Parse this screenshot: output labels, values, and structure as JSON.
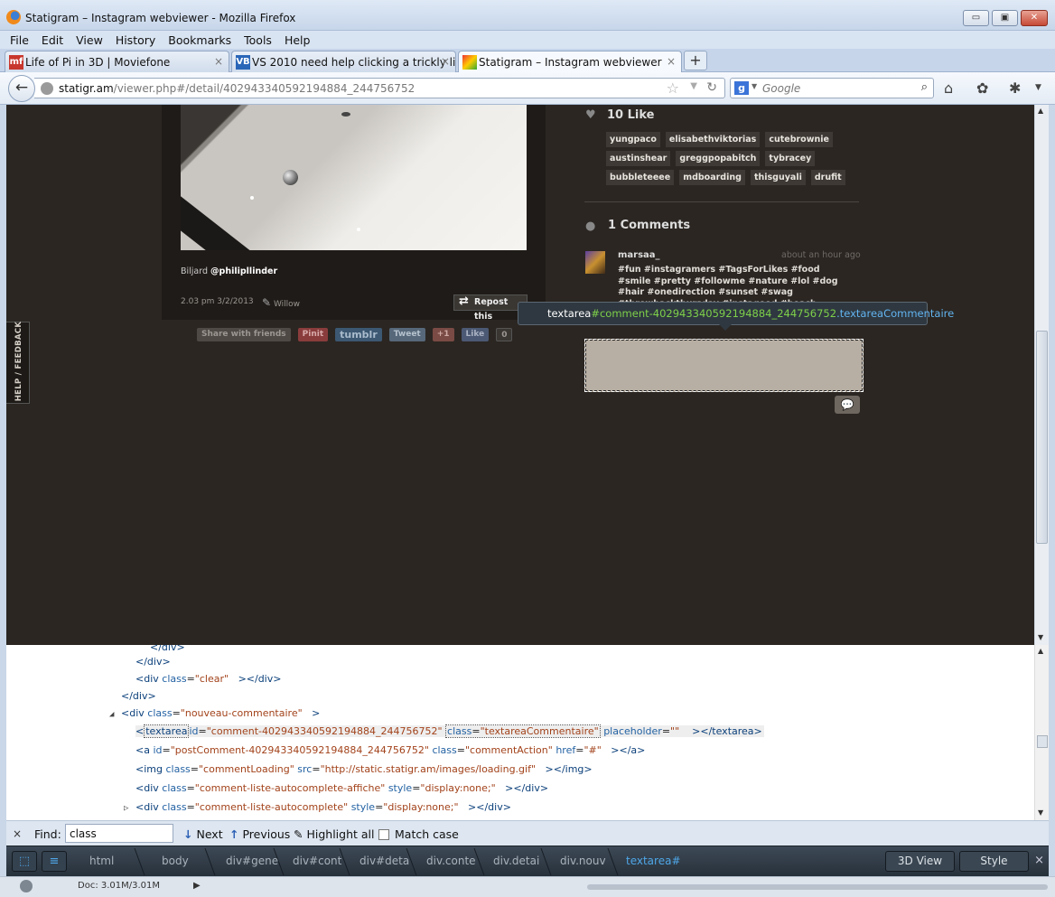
{
  "window": {
    "title": "Statigram – Instagram webviewer - Mozilla Firefox",
    "buttons": {
      "minimize": "▭",
      "restore": "▣",
      "close": "✕"
    }
  },
  "menu": [
    "File",
    "Edit",
    "View",
    "History",
    "Bookmarks",
    "Tools",
    "Help"
  ],
  "tabs": [
    {
      "label": "Life of Pi in 3D | Moviefone",
      "icon": "mf",
      "close": "×"
    },
    {
      "label": "VS 2010 need help clicking a trickly lil ...",
      "icon": "VB",
      "close": "×"
    },
    {
      "label": "Statigram – Instagram webviewer",
      "icon": "",
      "close": "×",
      "active": true
    }
  ],
  "newtab_label": "+",
  "navigation": {
    "back": "←",
    "url_host": "statigr.am",
    "url_path": "/viewer.php#/detail/402943340592194884_244756752",
    "search_placeholder": "Google",
    "search_engine_letter": "g"
  },
  "post": {
    "caption_prefix": "Biljard ",
    "caption_user": "@philipllinder",
    "time": "2.03 pm 3/2/2013",
    "filter": "Willow",
    "repost_label": "Repost this",
    "share": [
      "Share with friends",
      "Pinit",
      "tumblr",
      "Tweet",
      "+1",
      "Like",
      "0"
    ]
  },
  "feedback_label": "HELP / FEEDBACK",
  "likes": {
    "heading": "10 Like",
    "users": [
      "yungpaco",
      "elisabethviktorias",
      "cutebrownie",
      "austinshear",
      "greggpopabitch",
      "tybracey",
      "bubbleteeee",
      "mdboarding",
      "thisguyali",
      "drufit"
    ]
  },
  "comments": {
    "heading": "1 Comments",
    "user": "marsaa_",
    "time": "about an hour ago",
    "text": "#fun #instagramers #TagsForLikes #food #smile #pretty #followme #nature #lol #dog #hair #onedirection #sunset #swag #throwbackthursday #instagood #beach #statigram #friends #hot #funny #bestoftheday #clouds",
    "send_icon": "💬"
  },
  "inspector_tip": {
    "tag": "textarea",
    "id": "#comment-402943340592194884_244756752",
    "cls": ".textareaCommentaire"
  },
  "devtools": {
    "lines": {
      "l0": "</div>",
      "l1": "</div>",
      "l2_tag": "<div ",
      "l2_attr": "class",
      "l2_val": "\"clear\"",
      "l2_end": "></div>",
      "l3": "</div>",
      "l4_tag": "<div ",
      "l4_attr": "class",
      "l4_val": "\"nouveau-commentaire\"",
      "l4_end": ">",
      "l5_tag": "textarea",
      "l5_id_attr": "id",
      "l5_id_val": "\"comment-402943340592194884_244756752\"",
      "l5_cls_attr": "class",
      "l5_cls_val": "\"textareaCommentaire\"",
      "l5_ph_attr": "placeholder",
      "l5_ph_val": "\"\"",
      "l5_end": "textarea>",
      "l6_tag": "<a ",
      "l6_id_attr": "id",
      "l6_id_val": "\"postComment-402943340592194884_244756752\"",
      "l6_cls_attr": "class",
      "l6_cls_val": "\"commentAction\"",
      "l6_href_attr": "href",
      "l6_href_val": "\"#\"",
      "l6_end": "></a>",
      "l7_tag": "<img ",
      "l7_cls_attr": "class",
      "l7_cls_val": "\"commentLoading\"",
      "l7_src_attr": "src",
      "l7_src_val": "\"http://static.statigr.am/images/loading.gif\"",
      "l7_end": "></img>",
      "l8_tag": "<div ",
      "l8_cls_attr": "class",
      "l8_cls_val": "\"comment-liste-autocomplete-affiche\"",
      "l8_style_attr": "style",
      "l8_style_val": "\"display:none;\"",
      "l8_end": "></div>",
      "l9_tag": "<div ",
      "l9_cls_attr": "class",
      "l9_cls_val": "\"comment-liste-autocomplete\"",
      "l9_style_attr": "style",
      "l9_style_val": "\"display:none;\"",
      "l9_end": "></div>"
    }
  },
  "findbar": {
    "close": "×",
    "label": "Find:",
    "query": "class",
    "next": "Next",
    "previous": "Previous",
    "highlight": "Highlight all",
    "matchcase": "Match case"
  },
  "breadcrumbs": [
    "html",
    "body",
    "div#gene",
    "div#cont",
    "div#deta",
    "div.conte",
    "div.detai",
    "div.nouv",
    "textarea#"
  ],
  "devtools_buttons": {
    "view3d": "3D View",
    "style": "Style",
    "close": "×"
  },
  "status": {
    "doc": "Doc: 3.01M/3.01M"
  }
}
